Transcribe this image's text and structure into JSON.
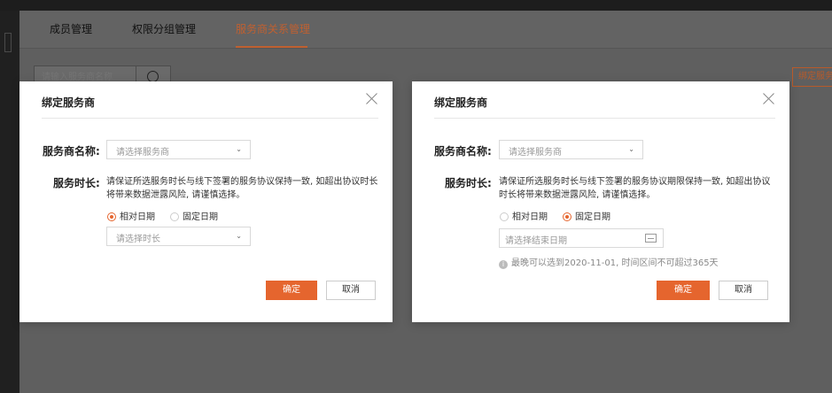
{
  "topbar": {
    "brand": "",
    "notice": "",
    "nav": [
      "",
      "",
      ""
    ]
  },
  "tabs": [
    {
      "label": "成员管理",
      "active": false
    },
    {
      "label": "权限分组管理",
      "active": false
    },
    {
      "label": "服务商关系管理",
      "active": true
    }
  ],
  "search": {
    "placeholder": "请输入服务商名称"
  },
  "bind_button": {
    "label": "绑定服务商"
  },
  "modal_relative": {
    "title": "绑定服务商",
    "provider_label": "服务商名称:",
    "provider_placeholder": "请选择服务商",
    "duration_label": "服务时长:",
    "hint_line1": "请保证所选服务时长与线下签署的服务协议保持一致, 如超出协议时长",
    "hint_line2": "将带来数据泄露风险, 请谨慎选择。",
    "radio_relative": "相对日期",
    "radio_fixed": "固定日期",
    "selected": "相对日期",
    "duration_placeholder": "请选择时长",
    "ok": "确定",
    "cancel": "取消"
  },
  "modal_fixed": {
    "title": "绑定服务商",
    "provider_label": "服务商名称:",
    "provider_placeholder": "请选择服务商",
    "duration_label": "服务时长:",
    "hint_line1": "请保证所选服务时长与线下签署的服务协议期限保持一致, 如超出协议",
    "hint_line2": "时长将带来数据泄露风险, 请谨慎选择。",
    "radio_relative": "相对日期",
    "radio_fixed": "固定日期",
    "selected": "固定日期",
    "end_date_placeholder": "请选择结束日期",
    "info": "最晚可以选到2020-11-01, 时间区间不可超过365天",
    "ok": "确定",
    "cancel": "取消"
  },
  "colors": {
    "accent": "#e5652e",
    "overlay": "#5d5d5d"
  }
}
